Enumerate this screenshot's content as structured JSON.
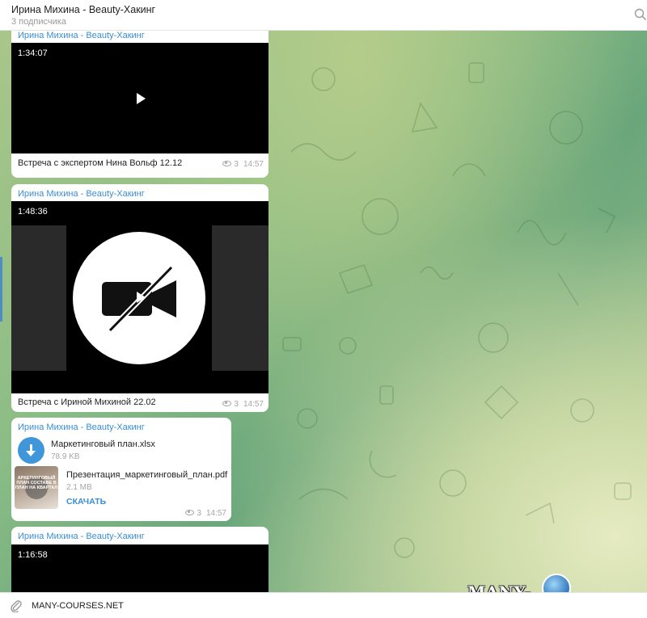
{
  "header": {
    "title": "Ирина Михина - Beauty-Хакинг",
    "subtitle": "3 подписчика",
    "search_icon": "search-icon"
  },
  "messages": [
    {
      "author": "Ирина Михина - Beauty-Хакинг",
      "duration": "1:34:07",
      "caption": "Встреча с экспертом Нина Вольф 12.12",
      "views": "3",
      "time": "14:57"
    },
    {
      "author": "Ирина Михина - Beauty-Хакинг",
      "duration": "1:48:36",
      "caption": "Встреча с Ириной Михиной 22.02",
      "views": "3",
      "time": "14:57"
    },
    {
      "author": "Ирина Михина - Beauty-Хакинг",
      "files": [
        {
          "name": "Маркетинговый план.xlsx",
          "size": "78.9 KB",
          "icon": "download-icon"
        },
        {
          "name": "Презентация_маркетинговый_план.pdf",
          "size": "2.1 MB",
          "action": "СКАЧАТЬ",
          "thumb_text": "АРКЕТИНГОВЫЙ ПЛАН СОСТАВЕ В ПЛАН НА КВАРТАЛ"
        }
      ],
      "views": "3",
      "time": "14:57"
    },
    {
      "author": "Ирина Михина - Beauty-Хакинг",
      "duration": "1:16:58"
    }
  ],
  "input": {
    "text": "MANY-COURSES.NET",
    "attach_icon": "paperclip-icon"
  },
  "watermark": "MANY-COURSES.NET",
  "colors": {
    "accent": "#3a8dd3",
    "download_button": "#3f96d8"
  }
}
